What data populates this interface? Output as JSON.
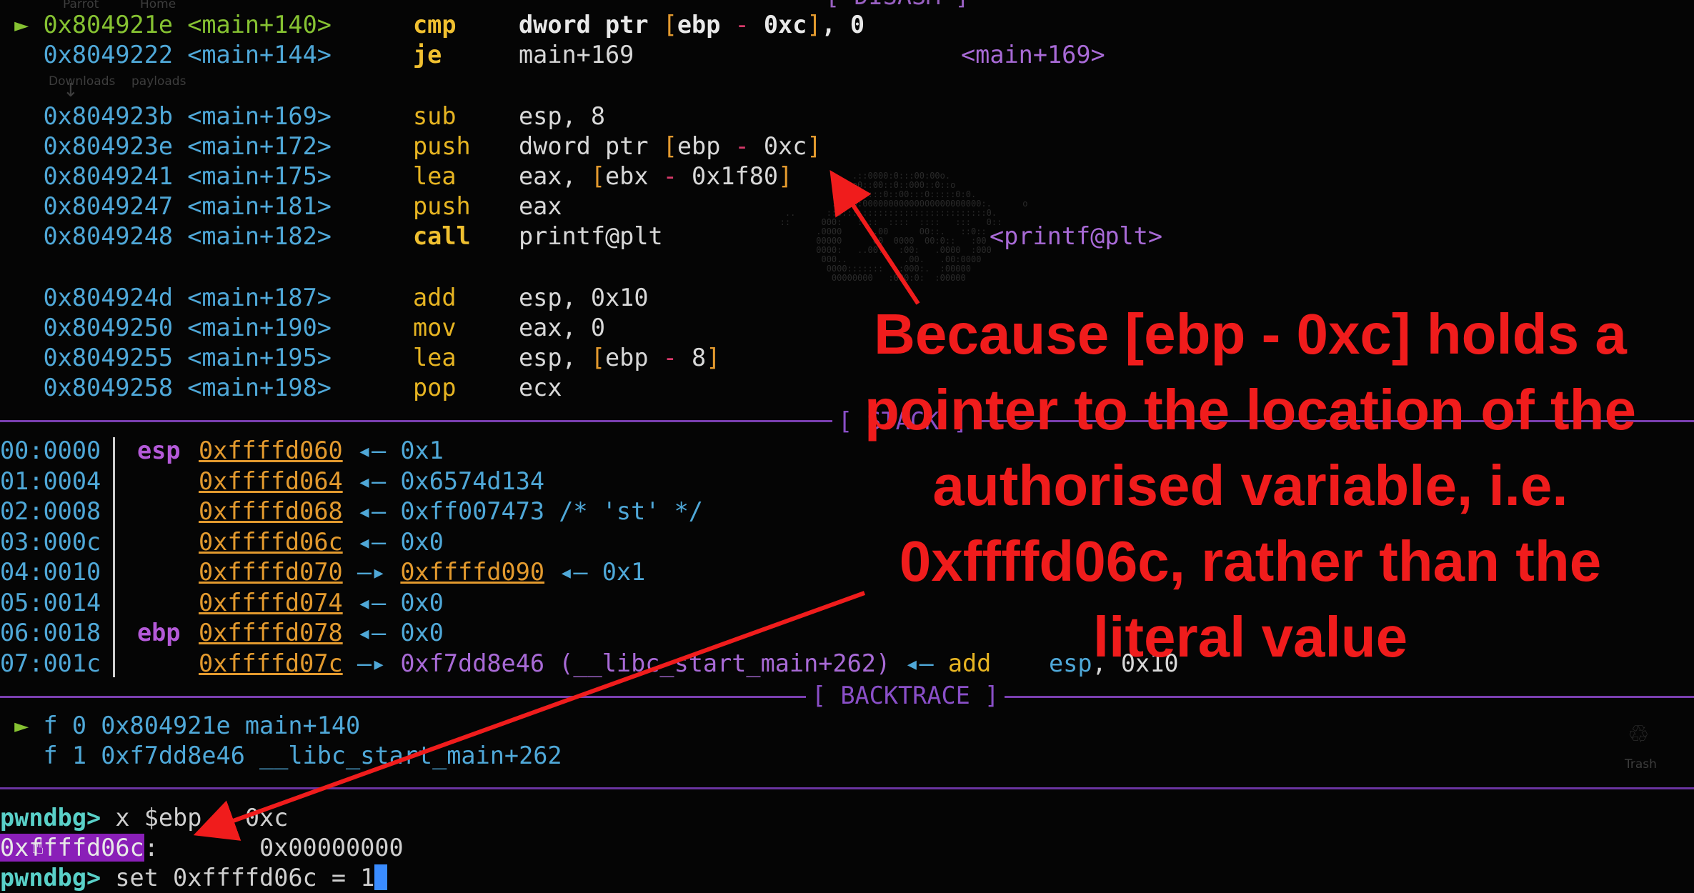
{
  "desktop": {
    "top_labels": [
      "Parrot",
      "Home"
    ],
    "side_labels": [
      "Downloads",
      "payloads"
    ],
    "trash_label": "Trash",
    "disasm_label_fragment": "[ DISASM ]"
  },
  "disasm": {
    "rows": [
      {
        "marker": "►",
        "addr": "0x804921e",
        "sym": "<main+140>",
        "mnem": "cmp",
        "bold": true,
        "ops": [
          [
            "op-b",
            "dword ptr "
          ],
          [
            "brk",
            "["
          ],
          [
            "op-b",
            "ebp "
          ],
          [
            "minus",
            "-"
          ],
          [
            "op-b",
            " 0xc"
          ],
          [
            "brk",
            "]"
          ],
          [
            "op-b",
            ", 0"
          ]
        ],
        "target": "",
        "current": true
      },
      {
        "marker": "",
        "addr": "0x8049222",
        "sym": "<main+144>",
        "mnem": "je",
        "bold": true,
        "ops": [
          [
            "op",
            "main+169"
          ]
        ],
        "target": "<main+169>"
      },
      {
        "marker": "",
        "addr": "0x804923b",
        "sym": "<main+169>",
        "mnem": "sub",
        "ops": [
          [
            "op",
            "esp, 8"
          ]
        ],
        "target": "",
        "gap": true
      },
      {
        "marker": "",
        "addr": "0x804923e",
        "sym": "<main+172>",
        "mnem": "push",
        "ops": [
          [
            "op",
            "dword ptr "
          ],
          [
            "brk",
            "["
          ],
          [
            "op",
            "ebp "
          ],
          [
            "minus",
            "-"
          ],
          [
            "op",
            " 0xc"
          ],
          [
            "brk",
            "]"
          ]
        ],
        "target": ""
      },
      {
        "marker": "",
        "addr": "0x8049241",
        "sym": "<main+175>",
        "mnem": "lea",
        "ops": [
          [
            "op",
            "eax, "
          ],
          [
            "brk",
            "["
          ],
          [
            "op",
            "ebx "
          ],
          [
            "minus",
            "-"
          ],
          [
            "op",
            " 0x1f80"
          ],
          [
            "brk",
            "]"
          ]
        ],
        "target": ""
      },
      {
        "marker": "",
        "addr": "0x8049247",
        "sym": "<main+181>",
        "mnem": "push",
        "ops": [
          [
            "op",
            "eax"
          ]
        ],
        "target": ""
      },
      {
        "marker": "",
        "addr": "0x8049248",
        "sym": "<main+182>",
        "mnem": "call",
        "bold": true,
        "ops": [
          [
            "op",
            "printf@plt"
          ]
        ],
        "target": "<printf@plt>"
      },
      {
        "marker": "",
        "addr": "0x804924d",
        "sym": "<main+187>",
        "mnem": "add",
        "ops": [
          [
            "op",
            "esp, 0x10"
          ]
        ],
        "target": "",
        "gap": true
      },
      {
        "marker": "",
        "addr": "0x8049250",
        "sym": "<main+190>",
        "mnem": "mov",
        "ops": [
          [
            "op",
            "eax, 0"
          ]
        ],
        "target": ""
      },
      {
        "marker": "",
        "addr": "0x8049255",
        "sym": "<main+195>",
        "mnem": "lea",
        "ops": [
          [
            "op",
            "esp, "
          ],
          [
            "brk",
            "["
          ],
          [
            "op",
            "ebp "
          ],
          [
            "minus",
            "-"
          ],
          [
            "op",
            " 8"
          ],
          [
            "brk",
            "]"
          ]
        ],
        "target": ""
      },
      {
        "marker": "",
        "addr": "0x8049258",
        "sym": "<main+198>",
        "mnem": "pop",
        "ops": [
          [
            "op",
            "ecx"
          ]
        ],
        "target": ""
      }
    ]
  },
  "stack": {
    "label": "[ STACK ]",
    "rows": [
      {
        "off": "00:0000",
        "reg": "esp",
        "addr": "0xffffd060",
        "arrow": "◂—",
        "rest": [
          [
            "val",
            "0x1"
          ]
        ]
      },
      {
        "off": "01:0004",
        "reg": "",
        "addr": "0xffffd064",
        "arrow": "◂—",
        "rest": [
          [
            "val",
            "0x6574d134"
          ]
        ]
      },
      {
        "off": "02:0008",
        "reg": "",
        "addr": "0xffffd068",
        "arrow": "◂—",
        "rest": [
          [
            "val",
            "0xff007473 /* 'st' */"
          ]
        ]
      },
      {
        "off": "03:000c",
        "reg": "",
        "addr": "0xffffd06c",
        "arrow": "◂—",
        "rest": [
          [
            "val",
            "0x0"
          ]
        ]
      },
      {
        "off": "04:0010",
        "reg": "",
        "addr": "0xffffd070",
        "arrow": "—▸",
        "rest": [
          [
            "stk",
            "0xffffd090"
          ],
          [
            "lar",
            " ◂— "
          ],
          [
            "val",
            "0x1"
          ]
        ]
      },
      {
        "off": "05:0014",
        "reg": "",
        "addr": "0xffffd074",
        "arrow": "◂—",
        "rest": [
          [
            "val",
            "0x0"
          ]
        ]
      },
      {
        "off": "06:0018",
        "reg": "ebp",
        "addr": "0xffffd078",
        "arrow": "◂—",
        "rest": [
          [
            "val",
            "0x0"
          ]
        ]
      },
      {
        "off": "07:001c",
        "reg": "",
        "addr": "0xffffd07c",
        "arrow": "—▸",
        "rest": [
          [
            "purple",
            "0xf7dd8e46 (__libc_start_main+262)"
          ],
          [
            "lar",
            " ◂— "
          ],
          [
            "mn",
            "add"
          ],
          [
            "op",
            "    "
          ],
          [
            "val",
            "esp"
          ],
          [
            "op",
            ", 0x10"
          ]
        ]
      }
    ]
  },
  "backtrace": {
    "label": "[ BACKTRACE ]",
    "frames": [
      {
        "marker": "►",
        "text": "f 0 0x804921e main+140"
      },
      {
        "marker": "",
        "text": "f 1 0xf7dd8e46 __libc_start_main+262"
      }
    ]
  },
  "console": {
    "prompt": "pwndbg>",
    "cmd1": " x $ebp - 0xc",
    "out_addr": "0xffffd06c",
    "out_rest": ":       0x00000000",
    "cmd2": " set 0xffffd06c = 1"
  },
  "annotation": {
    "lines": [
      "Because [ebp - 0xc] holds a",
      "pointer to the location of the",
      "authorised variable, i.e.",
      "0xffffd06c, rather than the",
      "literal value"
    ],
    "color": "#f01c1c"
  }
}
